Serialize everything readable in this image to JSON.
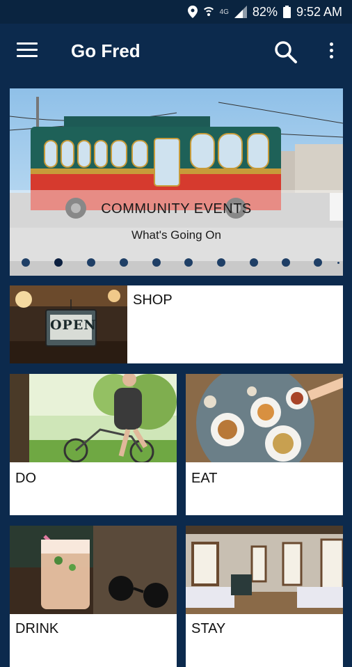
{
  "status_bar": {
    "battery": "82%",
    "time": "9:52 AM",
    "network": "4G"
  },
  "app_bar": {
    "title": "Go Fred",
    "icons": [
      "menu-icon",
      "search-icon",
      "more-vert-icon"
    ]
  },
  "hero": {
    "title": "COMMUNITY EVENTS",
    "subtitle": "What's Going On",
    "active_slide": 2,
    "slide_count": 10
  },
  "tiles": {
    "shop": {
      "label": "SHOP",
      "sign_text": "OPEN"
    },
    "do": {
      "label": "DO"
    },
    "eat": {
      "label": "EAT"
    },
    "drink": {
      "label": "DRINK"
    },
    "stay": {
      "label": "STAY"
    }
  },
  "colors": {
    "app_bar": "#0c2a4d",
    "status_bar": "#0a2440",
    "tile_background": "#ffffff"
  }
}
